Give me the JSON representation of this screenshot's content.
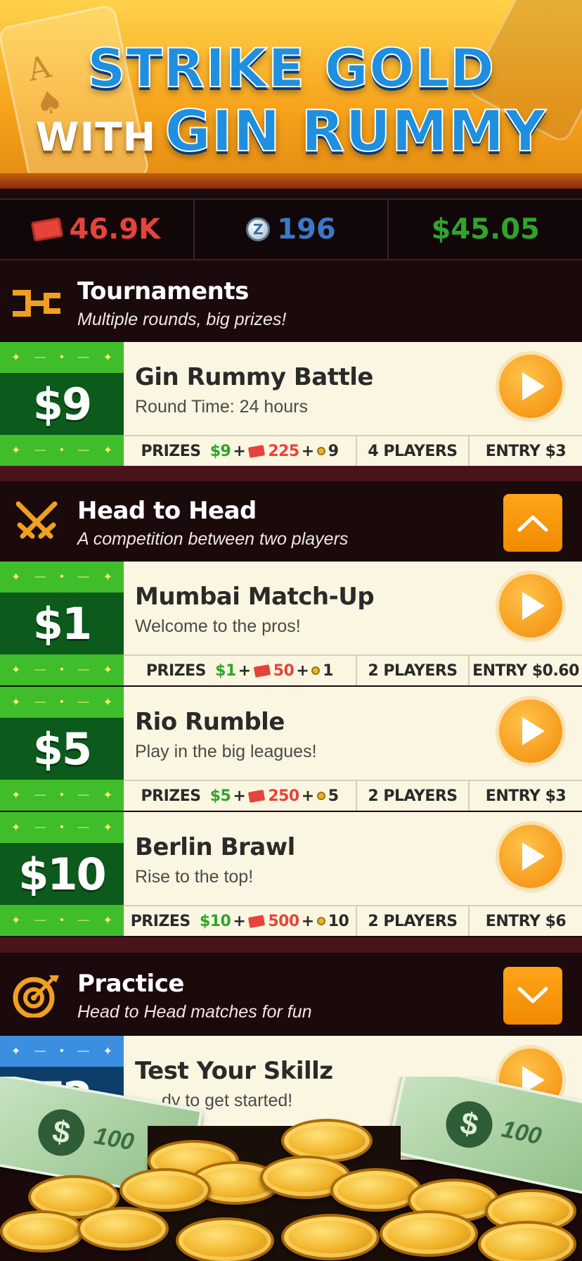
{
  "banner": {
    "line1": "STRIKE GOLD",
    "line2_small": "WITH",
    "line2_big": "GIN RUMMY"
  },
  "currency": {
    "tickets": "46.9K",
    "z_coins": "196",
    "z_icon_letter": "Z",
    "cash": "$45.05",
    "ticket_color": "#e5443a",
    "z_color": "#3a78c8",
    "cash_color": "#2ea52a"
  },
  "tournaments": {
    "title": "Tournaments",
    "subtitle": "Multiple rounds, big prizes!",
    "icon": "bracket-icon",
    "games": [
      {
        "stake": "$9",
        "title": "Gin Rummy Battle",
        "subtitle": "Round Time: 24 hours",
        "prizes_label": "PRIZES",
        "prize_cash": "$9",
        "prize_tickets": "225",
        "prize_medals": "9",
        "players": "4 PLAYERS",
        "entry": "ENTRY $3"
      }
    ]
  },
  "head_to_head": {
    "title": "Head to Head",
    "subtitle": "A competition between two players",
    "icon": "crossed-swords-icon",
    "toggle_icon": "chevron-up-icon",
    "games": [
      {
        "stake": "$1",
        "title": "Mumbai Match-Up",
        "subtitle": "Welcome to the pros!",
        "prizes_label": "PRIZES",
        "prize_cash": "$1",
        "prize_tickets": "50",
        "prize_medals": "1",
        "players": "2 PLAYERS",
        "entry": "ENTRY $0.60"
      },
      {
        "stake": "$5",
        "title": "Rio Rumble",
        "subtitle": "Play in the big leagues!",
        "prizes_label": "PRIZES",
        "prize_cash": "$5",
        "prize_tickets": "250",
        "prize_medals": "5",
        "players": "2 PLAYERS",
        "entry": "ENTRY $3"
      },
      {
        "stake": "$10",
        "title": "Berlin Brawl",
        "subtitle": "Rise to the top!",
        "prizes_label": "PRIZES",
        "prize_cash": "$10",
        "prize_tickets": "500",
        "prize_medals": "10",
        "players": "2 PLAYERS",
        "entry": "ENTRY $6"
      }
    ]
  },
  "practice": {
    "title": "Practice",
    "subtitle": "Head to Head matches for fun",
    "icon": "target-icon",
    "toggle_icon": "chevron-down-icon",
    "games": [
      {
        "stake": "Z2",
        "title": "Test Your Skillz",
        "subtitle": "dy to get started!"
      }
    ]
  },
  "footer_art": {
    "bill_symbol": "$",
    "bill_value": "100"
  }
}
